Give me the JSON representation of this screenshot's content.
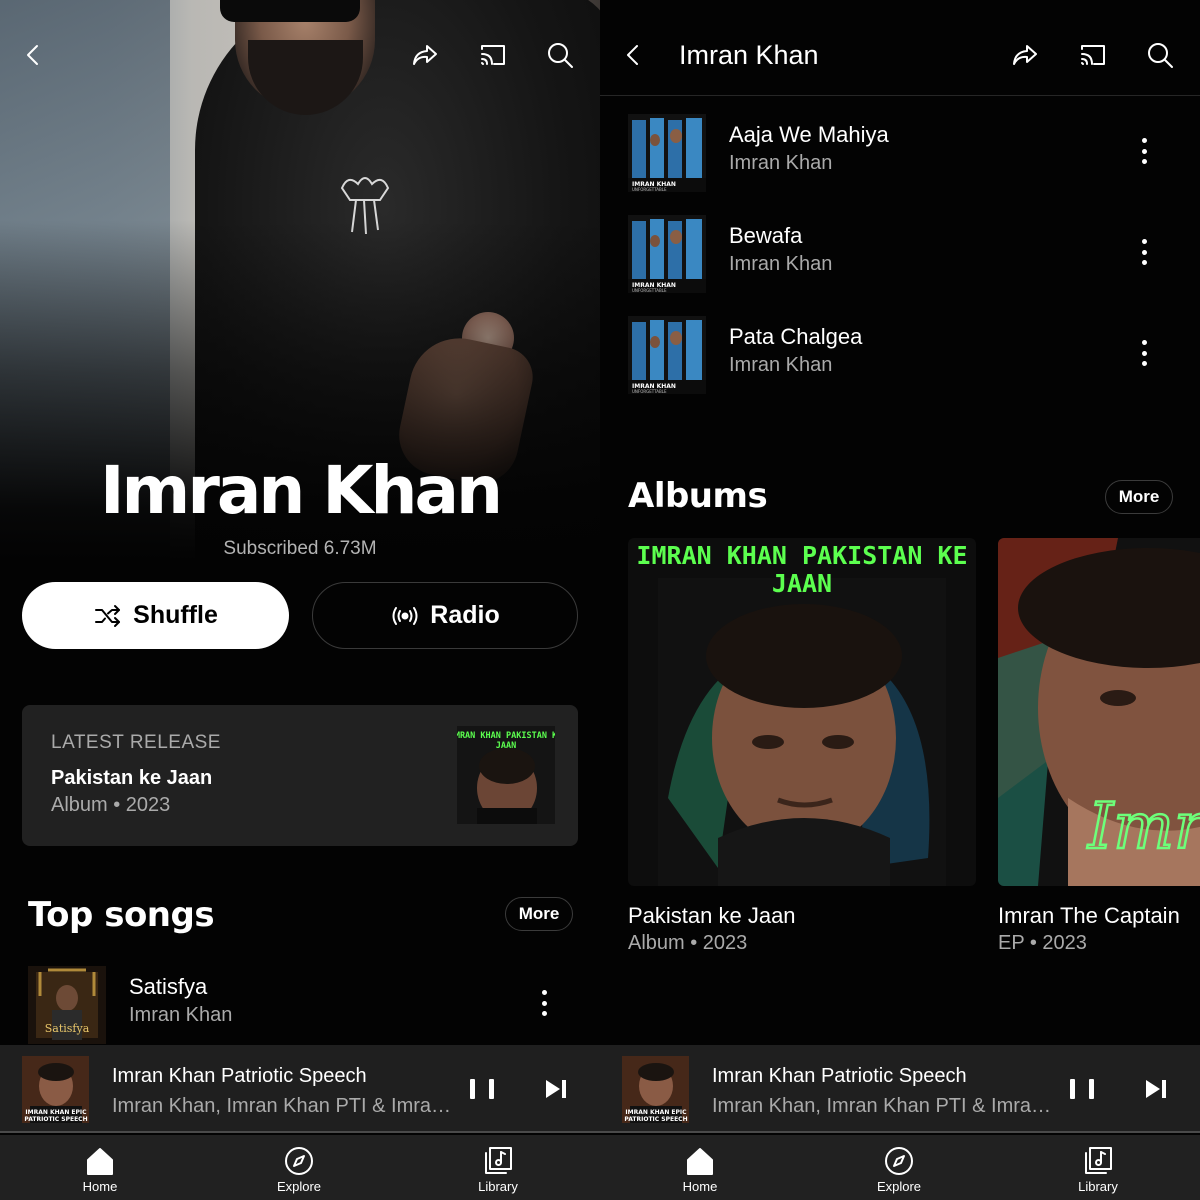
{
  "left": {
    "hero": {
      "artist_name": "Imran Khan",
      "subscribers": "Subscribed 6.73M"
    },
    "actions": {
      "shuffle_label": "Shuffle",
      "radio_label": "Radio"
    },
    "latest_release": {
      "label": "LATEST RELEASE",
      "title": "Pakistan ke Jaan",
      "meta": "Album • 2023",
      "art_text": "IMRAN KHAN PAKISTAN KE JAAN"
    },
    "top_songs": {
      "title": "Top songs",
      "more_label": "More",
      "songs": [
        {
          "title": "Satisfya",
          "artist": "Imran Khan"
        }
      ]
    }
  },
  "right": {
    "header_title": "Imran Khan",
    "songs": [
      {
        "title": "Aaja We Mahiya",
        "artist": "Imran Khan"
      },
      {
        "title": "Bewafa",
        "artist": "Imran Khan"
      },
      {
        "title": "Pata Chalgea",
        "artist": "Imran Khan"
      }
    ],
    "albums": {
      "title": "Albums",
      "more_label": "More",
      "items": [
        {
          "title": "Pakistan ke Jaan",
          "meta": "Album • 2023",
          "cover_text": "IMRAN KHAN PAKISTAN KE JAAN"
        },
        {
          "title": "Imran The Captain",
          "meta": "EP • 2023",
          "cover_text": "Imr"
        }
      ]
    }
  },
  "mini_player": {
    "title": "Imran Khan Patriotic Speech",
    "subtitle": "Imran Khan, Imran Khan PTI & Imran...",
    "progress": 0.0
  },
  "nav": {
    "home": "Home",
    "explore": "Explore",
    "library": "Library"
  },
  "colors": {
    "background": "#030303",
    "card": "#212121",
    "mini_player": "#1f1f1f",
    "secondary_text": "#aaaaaa",
    "neon_green": "#5cff4f"
  }
}
